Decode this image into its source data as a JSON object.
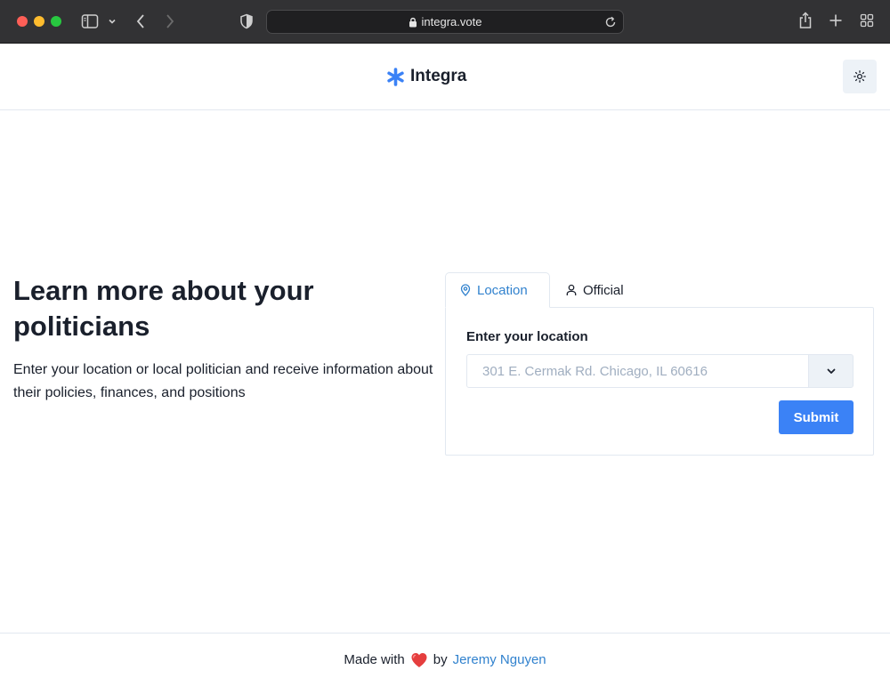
{
  "browser": {
    "url": "integra.vote"
  },
  "navbar": {
    "brand": "Integra"
  },
  "hero": {
    "title": "Learn more about your politicians",
    "subtitle": "Enter your location or local politician and receive information about their policies, finances, and positions"
  },
  "search_form": {
    "tabs": [
      {
        "label": "Location",
        "icon": "map-pin-icon",
        "active": true
      },
      {
        "label": "Official",
        "icon": "user-icon",
        "active": false
      }
    ],
    "field_label": "Enter your location",
    "input_value": "",
    "input_placeholder": "301 E. Cermak Rd. Chicago, IL 60616",
    "submit_label": "Submit"
  },
  "footer": {
    "prefix": "Made with",
    "middle": "by",
    "author": "Jeremy Nguyen"
  },
  "colors": {
    "accent": "#3b82f6",
    "link": "#3182ce",
    "heart": "#e53e3e"
  }
}
